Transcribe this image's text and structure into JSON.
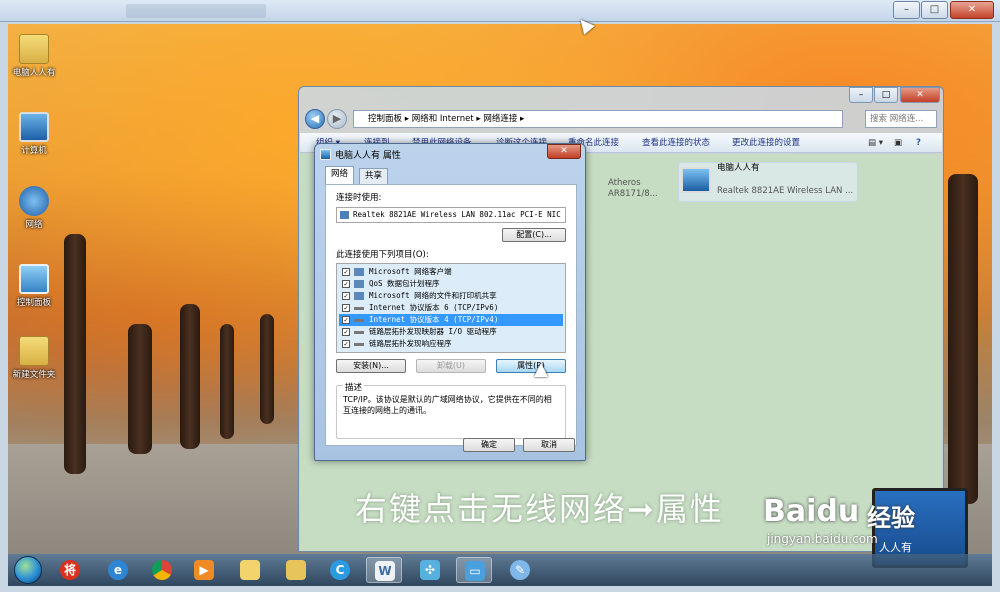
{
  "outer_window": {
    "buttons": {
      "minimize": "–",
      "maximize": "□",
      "close": "✕"
    }
  },
  "desktop": {
    "icons": [
      {
        "label": "电脑人人有",
        "icon": "folder-icon"
      },
      {
        "label": "计算机",
        "icon": "computer-icon"
      },
      {
        "label": "网络",
        "icon": "network-icon"
      },
      {
        "label": "控制面板",
        "icon": "control-panel-icon"
      },
      {
        "label": "新建文件夹",
        "icon": "folder-icon"
      }
    ]
  },
  "explorer": {
    "breadcrumb": [
      "控制面板",
      "网络和 Internet",
      "网络连接"
    ],
    "search_placeholder": "搜索 网络连...",
    "toolbar": [
      "组织 ▾",
      "连接到",
      "禁用此网络设备",
      "诊断这个连接",
      "重命名此连接",
      "查看此连接的状态",
      "更改此连接的设置"
    ],
    "adapters": [
      {
        "name": "",
        "device": "Atheros AR8171/8..."
      },
      {
        "name": "电脑人人有",
        "device": "Realtek 8821AE Wireless LAN ..."
      }
    ]
  },
  "dialog": {
    "title": "电脑人人有 属性",
    "close": "✕",
    "tabs": [
      "网络",
      "共享"
    ],
    "connect_using_label": "连接时使用:",
    "adapter_name": "Realtek 8821AE Wireless LAN 802.11ac PCI-E NIC",
    "configure_button": "配置(C)...",
    "items_label": "此连接使用下列项目(O):",
    "items": [
      {
        "label": "Microsoft 网络客户端",
        "checked": true,
        "selected": false
      },
      {
        "label": "QoS 数据包计划程序",
        "checked": true,
        "selected": false
      },
      {
        "label": "Microsoft 网络的文件和打印机共享",
        "checked": true,
        "selected": false
      },
      {
        "label": "Internet 协议版本 6 (TCP/IPv6)",
        "checked": true,
        "selected": false
      },
      {
        "label": "Internet 协议版本 4 (TCP/IPv4)",
        "checked": true,
        "selected": true
      },
      {
        "label": "链路层拓扑发现映射器 I/O 驱动程序",
        "checked": true,
        "selected": false
      },
      {
        "label": "链路层拓扑发现响应程序",
        "checked": true,
        "selected": false
      }
    ],
    "install_button": "安装(N)...",
    "uninstall_button": "卸载(U)",
    "properties_button": "属性(R)",
    "description_label": "描述",
    "description_text": "TCP/IP。该协议是默认的广域网络协议，它提供在不同的相互连接的网络上的通讯。",
    "ok_button": "确定",
    "cancel_button": "取消"
  },
  "overlay": {
    "caption": "右键点击无线网络➞属性",
    "watermark_logo": "Baidu",
    "watermark_jy": "经验",
    "watermark_url": "jingyan.baidu.com",
    "laptop_text": "人人有"
  },
  "taskbar": {
    "apps": [
      "start-orb",
      "pinyin-icon",
      "ie-icon",
      "chrome-icon",
      "media-player-icon",
      "explorer-icon",
      "folder-icon",
      "qq-browser-icon",
      "document-icon",
      "network-tool-icon",
      "network-connections-icon",
      "paint-icon"
    ]
  }
}
